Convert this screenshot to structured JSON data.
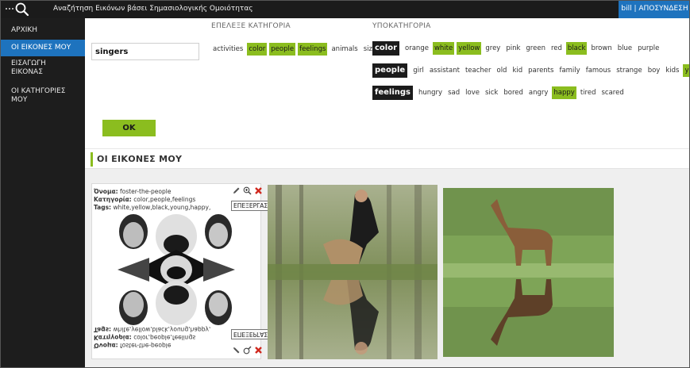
{
  "header": {
    "app_title": "Αναζήτηση Εικόνων βάσει Σημασιολογικής Ομοιότητας",
    "user_label": "bill | ΑΠΟΣΥΝΔΕΣΗ"
  },
  "sidebar": {
    "items": [
      {
        "label": "ΑΡΧΙΚΗ"
      },
      {
        "label": "ΟΙ ΕΙΚΟΝΕΣ ΜΟΥ"
      },
      {
        "label": "ΕΙΣΑΓΩΓΗ ΕΙΚΟΝΑΣ"
      },
      {
        "label": "ΟΙ ΚΑΤΗΓΟΡΙΕΣ ΜΟΥ"
      }
    ],
    "active_index": 1
  },
  "search": {
    "value": "singers"
  },
  "category": {
    "label": "ΕΠΕΛΕΞΕ ΚΑΤΗΓΟΡΙΑ",
    "items": [
      {
        "label": "activities",
        "selected": false
      },
      {
        "label": "color",
        "selected": true
      },
      {
        "label": "people",
        "selected": true
      },
      {
        "label": "feelings",
        "selected": true
      },
      {
        "label": "animals",
        "selected": false
      },
      {
        "label": "size",
        "selected": false
      }
    ]
  },
  "subcategory": {
    "label": "ΥΠΟΚΑΤΗΓΟΡΙΑ",
    "groups": [
      {
        "name": "color",
        "items": [
          {
            "label": "orange",
            "state": "none"
          },
          {
            "label": "white",
            "state": "green"
          },
          {
            "label": "yellow",
            "state": "green"
          },
          {
            "label": "grey",
            "state": "none"
          },
          {
            "label": "pink",
            "state": "none"
          },
          {
            "label": "green",
            "state": "none"
          },
          {
            "label": "red",
            "state": "none"
          },
          {
            "label": "black",
            "state": "green"
          },
          {
            "label": "brown",
            "state": "none"
          },
          {
            "label": "blue",
            "state": "none"
          },
          {
            "label": "purple",
            "state": "none"
          }
        ]
      },
      {
        "name": "people",
        "items": [
          {
            "label": "girl",
            "state": "none"
          },
          {
            "label": "assistant",
            "state": "none"
          },
          {
            "label": "teacher",
            "state": "none"
          },
          {
            "label": "old",
            "state": "none"
          },
          {
            "label": "kid",
            "state": "none"
          },
          {
            "label": "parents",
            "state": "none"
          },
          {
            "label": "family",
            "state": "none"
          },
          {
            "label": "famous",
            "state": "none"
          },
          {
            "label": "strange",
            "state": "none"
          },
          {
            "label": "boy",
            "state": "none"
          },
          {
            "label": "kids",
            "state": "none"
          },
          {
            "label": "young",
            "state": "green"
          }
        ]
      },
      {
        "name": "feelings",
        "items": [
          {
            "label": "hungry",
            "state": "none"
          },
          {
            "label": "sad",
            "state": "none"
          },
          {
            "label": "love",
            "state": "none"
          },
          {
            "label": "sick",
            "state": "none"
          },
          {
            "label": "bored",
            "state": "none"
          },
          {
            "label": "angry",
            "state": "none"
          },
          {
            "label": "happy",
            "state": "green"
          },
          {
            "label": "tired",
            "state": "none"
          },
          {
            "label": "scared",
            "state": "none"
          }
        ]
      }
    ]
  },
  "ok_button": {
    "label": "OK"
  },
  "my_images": {
    "title": "ΟΙ ΕΙΚΟΝΕΣ ΜΟΥ"
  },
  "card": {
    "name_label": "Όνομα:",
    "name_value": "foster-the-people",
    "category_label": "Κατηγορία:",
    "category_value": "color,people,feelings",
    "tags_label": "Tags:",
    "tags_value": "white,yellow,black,young,happy,",
    "edit_tooltip": "ΕΠΕΞΕΡΓΑΣΙΑ",
    "icons": [
      "pencil-icon",
      "zoom-in-icon",
      "delete-icon"
    ]
  },
  "colors": {
    "topbar": "#1b1b1b",
    "sidebar": "#1d1d1d",
    "accent_blue": "#1e73be",
    "accent_green": "#8bbd1f",
    "delete_red": "#d0281e"
  }
}
